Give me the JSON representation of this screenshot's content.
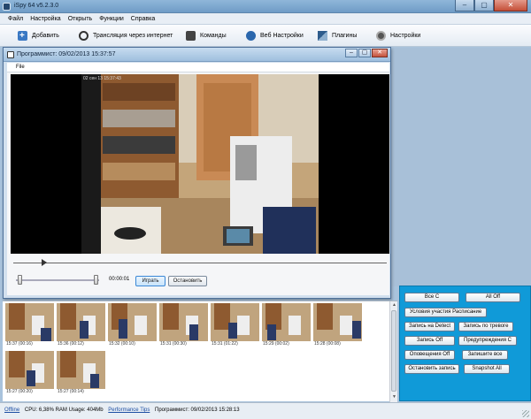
{
  "window": {
    "title": "iSpy 64 v5.2.3.0",
    "controls": [
      "–",
      "▢",
      "✕"
    ]
  },
  "menu": {
    "items": [
      "Файл",
      "Настройка",
      "Открыть",
      "Функции",
      "Справка"
    ]
  },
  "toolbar": {
    "items": [
      {
        "label": "Добавить",
        "icon": "add-icon"
      },
      {
        "label": "Трансляция через интернет",
        "icon": "broadcast-icon"
      },
      {
        "label": "Команды",
        "icon": "commands-icon"
      },
      {
        "label": "Веб Настройки",
        "icon": "web-settings-icon"
      },
      {
        "label": "Плагины",
        "icon": "plugins-icon"
      },
      {
        "label": "Настройки",
        "icon": "settings-icon"
      }
    ]
  },
  "preview": {
    "title": "Программист: 09/02/2013 15:37:57",
    "menu_file": "File",
    "video_timestamp": "02 сен 13 15:37:43",
    "time": "00:00:01",
    "play_label": "Играть",
    "stop_label": "Остановить"
  },
  "thumbnails": [
    {
      "caption": "15:37 (00:16)"
    },
    {
      "caption": "15:36 (00:12)"
    },
    {
      "caption": "15:32 (00:10)"
    },
    {
      "caption": "15:31 (00:30)"
    },
    {
      "caption": "15:31 (01:22)"
    },
    {
      "caption": "15:29 (00:02)"
    },
    {
      "caption": "15:28 (00:08)"
    },
    {
      "caption": "15:27 (00:20)"
    },
    {
      "caption": "15:27 (00:14)"
    }
  ],
  "actions": {
    "all_on": "Все С",
    "all_off": "All Off",
    "schedule": "Условия участия Расписание",
    "record_detect": "Запись на Detect",
    "record_alarm": "Запись по тревоге",
    "record_off": "Запись Off",
    "alerts_on": "Предупреждения С",
    "alerts_off": "Оповещения Off",
    "record_all": "Запишите все",
    "stop_record": "Остановить запись",
    "snapshot_all": "Snapshot All"
  },
  "status": {
    "offline": "Offline",
    "stats": "CPU: 6,38% RAM Usage: 404Mb",
    "tips": "Performance Tips",
    "last_event": "Программист: 09/02/2013 15:28:13"
  },
  "colors": {
    "accent_panel": "#109ad8",
    "titlebar": "#7ea9d1"
  }
}
